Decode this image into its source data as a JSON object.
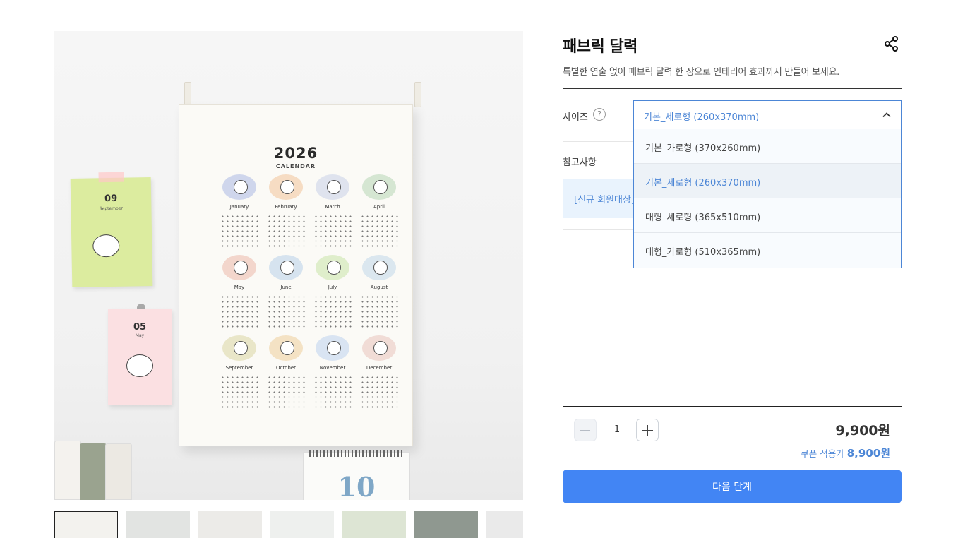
{
  "product": {
    "title": "패브릭 달력",
    "subtitle": "특별한 연출 없이 패브릭 달력 한 장으로 인테리어 효과까지 만들어 보세요."
  },
  "image": {
    "calendar_year": "2026",
    "calendar_sub": "CALENDAR",
    "months": [
      "January",
      "February",
      "March",
      "April",
      "May",
      "June",
      "July",
      "August",
      "September",
      "October",
      "November",
      "December"
    ],
    "note1_num": "09",
    "note1_month": "September",
    "note2_num": "05",
    "note2_month": "May",
    "desk_calendar_num": "10"
  },
  "options": {
    "size_label": "사이즈",
    "help_glyph": "?",
    "selected_value": "기본_세로형 (260x370mm)",
    "items": [
      "기본_가로형 (370x260mm)",
      "기본_세로형 (260x370mm)",
      "대형_세로형 (365x510mm)",
      "대형_가로형 (510x365mm)"
    ],
    "note_label": "참고사항",
    "promo_text": "[신규 회원대상]"
  },
  "purchase": {
    "quantity": "1",
    "price": "9,900원",
    "coupon_label": "쿠폰 적용가",
    "coupon_price": "8,900원",
    "next_button": "다음 단계"
  },
  "colors": {
    "accent": "#4285f4",
    "link_blue": "#4c86d6"
  }
}
